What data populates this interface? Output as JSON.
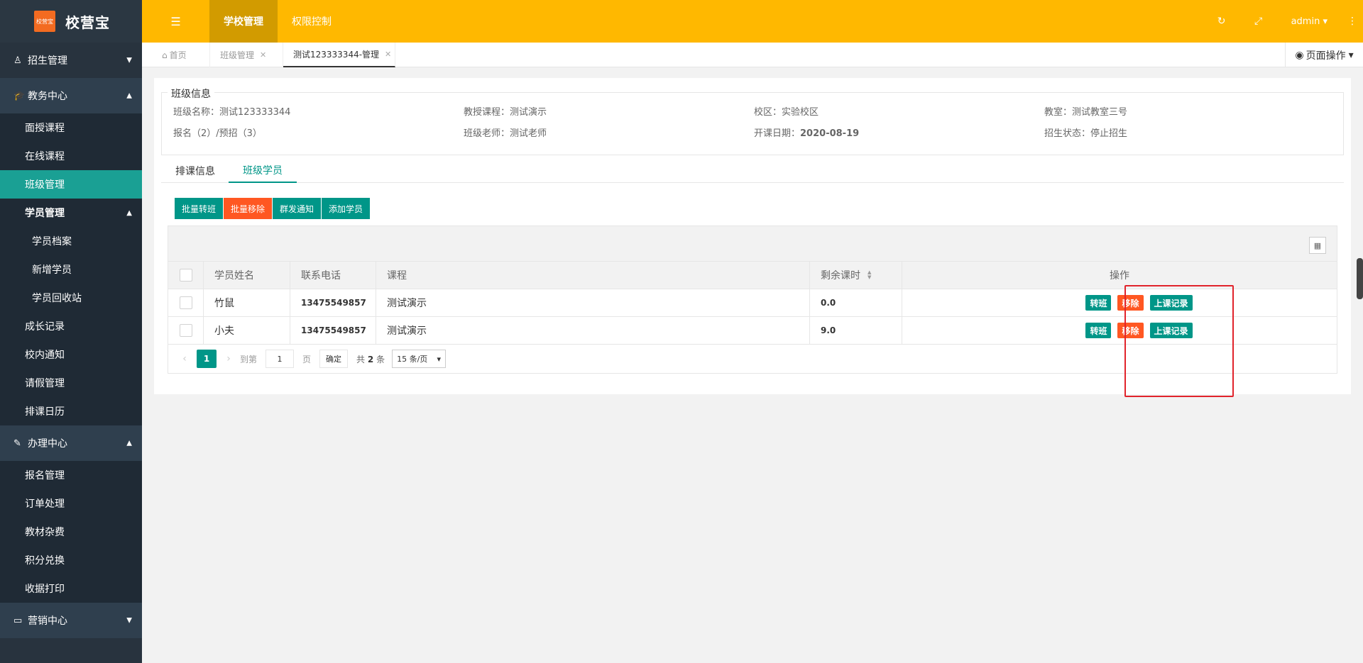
{
  "app": {
    "logo_badge": "校营宝",
    "logo_text": "校营宝"
  },
  "sidebar": {
    "groups": [
      {
        "label": "招生管理",
        "icon": "person-icon",
        "arrow": "▼"
      },
      {
        "label": "教务中心",
        "icon": "graduation-cap-icon",
        "arrow": "▲"
      },
      {
        "label": "办理中心",
        "icon": "edit-icon",
        "arrow": "▲"
      },
      {
        "label": "营销中心",
        "icon": "laptop-icon",
        "arrow": "▼"
      }
    ],
    "edu_items": [
      "面授课程",
      "在线课程",
      "班级管理",
      "学员管理",
      "成长记录",
      "校内通知",
      "请假管理",
      "排课日历"
    ],
    "student_sub": [
      "学员档案",
      "新增学员",
      "学员回收站"
    ],
    "office_items": [
      "报名管理",
      "订单处理",
      "教材杂费",
      "积分兑换",
      "收据打印"
    ]
  },
  "topbar": {
    "menu": [
      "学校管理",
      "权限控制"
    ],
    "user": "admin"
  },
  "tabs": {
    "items": [
      "首页",
      "班级管理",
      "测试123333344-管理"
    ],
    "page_ops": "页面操作"
  },
  "class_info": {
    "legend": "班级信息",
    "name_label": "班级名称：",
    "name": "测试123333344",
    "course_label": "教授课程：",
    "course": "测试演示",
    "campus_label": "校区：",
    "campus": "实验校区",
    "room_label": "教室：",
    "room": "测试教室三号",
    "enroll": "报名（2）/预招（3）",
    "teacher_label": "班级老师：",
    "teacher": "测试老师",
    "start_label": "开课日期：",
    "start": "2020-08-19",
    "status_label": "招生状态：",
    "status": "停止招生"
  },
  "subtabs": [
    "排课信息",
    "班级学员"
  ],
  "actions": [
    "批量转班",
    "批量移除",
    "群发通知",
    "添加学员"
  ],
  "table": {
    "headers": [
      "学员姓名",
      "联系电话",
      "课程",
      "剩余课时",
      "操作"
    ],
    "rows": [
      {
        "name": "竹鼠",
        "phone": "13475549857",
        "course": "测试演示",
        "hours": "0.0"
      },
      {
        "name": "小夫",
        "phone": "13475549857",
        "course": "测试演示",
        "hours": "9.0"
      }
    ],
    "row_actions": [
      "转班",
      "移除",
      "上课记录"
    ]
  },
  "pager": {
    "current": "1",
    "goto_label": "到第",
    "goto_value": "1",
    "page_label": "页",
    "confirm": "确定",
    "total_prefix": "共",
    "total": "2",
    "total_suffix": "条",
    "page_size": "15 条/页"
  },
  "colors": {
    "accent": "#009688",
    "danger": "#ff5722",
    "topbar": "#ffb800",
    "sidebar": "#28333e",
    "highlight": "#e1232b"
  }
}
